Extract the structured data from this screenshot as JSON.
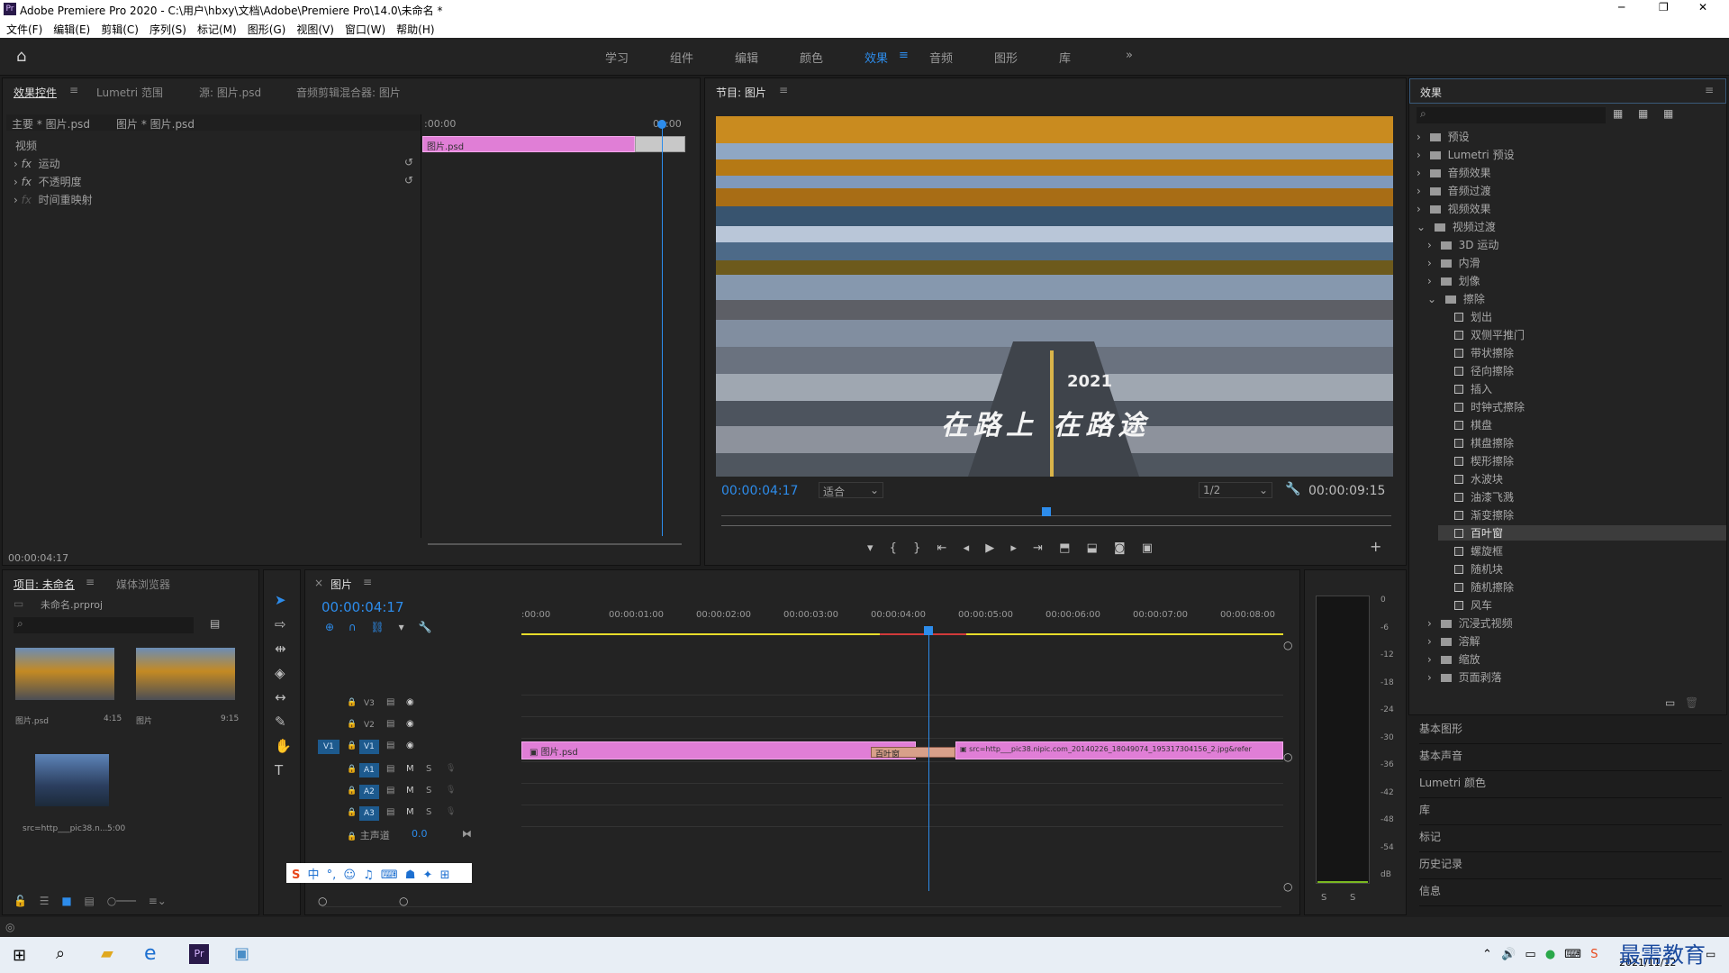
{
  "title": "Adobe Premiere Pro 2020 - C:\\用户\\hbxy\\文档\\Adobe\\Premiere Pro\\14.0\\未命名 *",
  "menu": [
    "文件(F)",
    "编辑(E)",
    "剪辑(C)",
    "序列(S)",
    "标记(M)",
    "图形(G)",
    "视图(V)",
    "窗口(W)",
    "帮助(H)"
  ],
  "workspaces": [
    "学习",
    "组件",
    "编辑",
    "颜色",
    "效果",
    "音频",
    "图形",
    "库"
  ],
  "effect_controls": {
    "tabs": [
      "效果控件",
      "Lumetri 范围",
      "源: 图片.psd",
      "音频剪辑混合器: 图片"
    ],
    "master": "主要 * 图片.psd",
    "clip": "图片 * 图片.psd",
    "video_label": "视频",
    "fx": [
      "运动",
      "不透明度",
      "时间重映射"
    ],
    "ruler_start": ":00:00",
    "ruler_end": "00:00",
    "clip_name": "图片.psd",
    "timecode": "00:00:04:17"
  },
  "program": {
    "title": "节目: 图片",
    "timecode": "00:00:04:17",
    "fit": "适合",
    "quality": "1/2",
    "duration": "00:00:09:15",
    "overlay_text_1": "2021",
    "overlay_text_2": "在路上 在路途"
  },
  "effects_panel": {
    "title": "效果",
    "items": [
      {
        "label": "预设",
        "type": "folder",
        "indent": 0,
        "expanded": false
      },
      {
        "label": "Lumetri 预设",
        "type": "folder",
        "indent": 0,
        "expanded": false
      },
      {
        "label": "音频效果",
        "type": "folder",
        "indent": 0,
        "expanded": false
      },
      {
        "label": "音频过渡",
        "type": "folder",
        "indent": 0,
        "expanded": false
      },
      {
        "label": "视频效果",
        "type": "folder",
        "indent": 0,
        "expanded": false
      },
      {
        "label": "视频过渡",
        "type": "folder",
        "indent": 0,
        "expanded": true
      },
      {
        "label": "3D 运动",
        "type": "folder",
        "indent": 1,
        "expanded": false
      },
      {
        "label": "内滑",
        "type": "folder",
        "indent": 1,
        "expanded": false
      },
      {
        "label": "划像",
        "type": "folder",
        "indent": 1,
        "expanded": false
      },
      {
        "label": "擦除",
        "type": "folder",
        "indent": 1,
        "expanded": true
      },
      {
        "label": "划出",
        "type": "fx",
        "indent": 2
      },
      {
        "label": "双侧平推门",
        "type": "fx",
        "indent": 2
      },
      {
        "label": "带状擦除",
        "type": "fx",
        "indent": 2
      },
      {
        "label": "径向擦除",
        "type": "fx",
        "indent": 2
      },
      {
        "label": "插入",
        "type": "fx",
        "indent": 2
      },
      {
        "label": "时钟式擦除",
        "type": "fx",
        "indent": 2
      },
      {
        "label": "棋盘",
        "type": "fx",
        "indent": 2
      },
      {
        "label": "棋盘擦除",
        "type": "fx",
        "indent": 2
      },
      {
        "label": "楔形擦除",
        "type": "fx",
        "indent": 2
      },
      {
        "label": "水波块",
        "type": "fx",
        "indent": 2
      },
      {
        "label": "油漆飞溅",
        "type": "fx",
        "indent": 2
      },
      {
        "label": "渐变擦除",
        "type": "fx",
        "indent": 2
      },
      {
        "label": "百叶窗",
        "type": "fx",
        "indent": 2,
        "selected": true
      },
      {
        "label": "螺旋框",
        "type": "fx",
        "indent": 2
      },
      {
        "label": "随机块",
        "type": "fx",
        "indent": 2
      },
      {
        "label": "随机擦除",
        "type": "fx",
        "indent": 2
      },
      {
        "label": "风车",
        "type": "fx",
        "indent": 2
      },
      {
        "label": "沉浸式视频",
        "type": "folder",
        "indent": 1,
        "expanded": false
      },
      {
        "label": "溶解",
        "type": "folder",
        "indent": 1,
        "expanded": false
      },
      {
        "label": "缩放",
        "type": "folder",
        "indent": 1,
        "expanded": false
      },
      {
        "label": "页面剥落",
        "type": "folder",
        "indent": 1,
        "expanded": false
      }
    ],
    "sections": [
      "基本图形",
      "基本声音",
      "Lumetri 颜色",
      "库",
      "标记",
      "历史记录",
      "信息"
    ]
  },
  "project": {
    "tabs": [
      "项目: 未命名",
      "媒体浏览器"
    ],
    "file": "未命名.prproj",
    "items": [
      {
        "name": "图片.psd",
        "dur": "4:15"
      },
      {
        "name": "图片",
        "dur": "9:15"
      },
      {
        "name": "src=http___pic38.n...",
        "dur": "5:00"
      }
    ]
  },
  "timeline": {
    "title": "图片",
    "timecode": "00:00:04:17",
    "ruler": [
      ":00:00",
      "00:00:01:00",
      "00:00:02:00",
      "00:00:03:00",
      "00:00:04:00",
      "00:00:05:00",
      "00:00:06:00",
      "00:00:07:00",
      "00:00:08:00"
    ],
    "tracks": [
      "V3",
      "V2",
      "V1",
      "A1",
      "A2",
      "A3"
    ],
    "master": "主声道",
    "master_val": "0.0",
    "clip1": "图片.psd",
    "transition": "百叶窗",
    "clip2": "src=http___pic38.nipic.com_20140226_18049074_195317304156_2.jpg&refer"
  },
  "meter": [
    "0",
    "-6",
    "-12",
    "-18",
    "-24",
    "-30",
    "-36",
    "-42",
    "-48",
    "-54",
    "dB"
  ],
  "taskbar": {
    "date": "2021/11/12",
    "watermark": "最需教育"
  },
  "colors": {
    "accent": "#2d8ceb",
    "clip": "#e07ed6"
  }
}
